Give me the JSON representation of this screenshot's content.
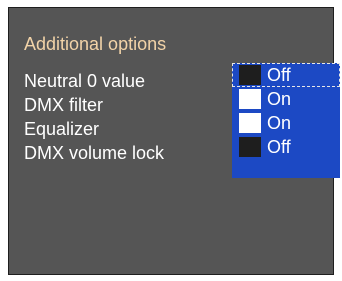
{
  "menu": {
    "title": "Additional options",
    "items": [
      {
        "label": "Neutral 0 value",
        "value": "Off",
        "state": "off",
        "focused": true
      },
      {
        "label": "DMX filter",
        "value": "On",
        "state": "on",
        "focused": false
      },
      {
        "label": "Equalizer",
        "value": "On",
        "state": "on",
        "focused": false
      },
      {
        "label": "DMX volume lock",
        "value": "Off",
        "state": "off",
        "focused": false
      }
    ]
  },
  "colors": {
    "panel_bg": "#555555",
    "title_text": "#f2d3a8",
    "value_bg": "#1c49c4",
    "swatch_on": "#ffffff",
    "swatch_off": "#1e1e1e"
  }
}
